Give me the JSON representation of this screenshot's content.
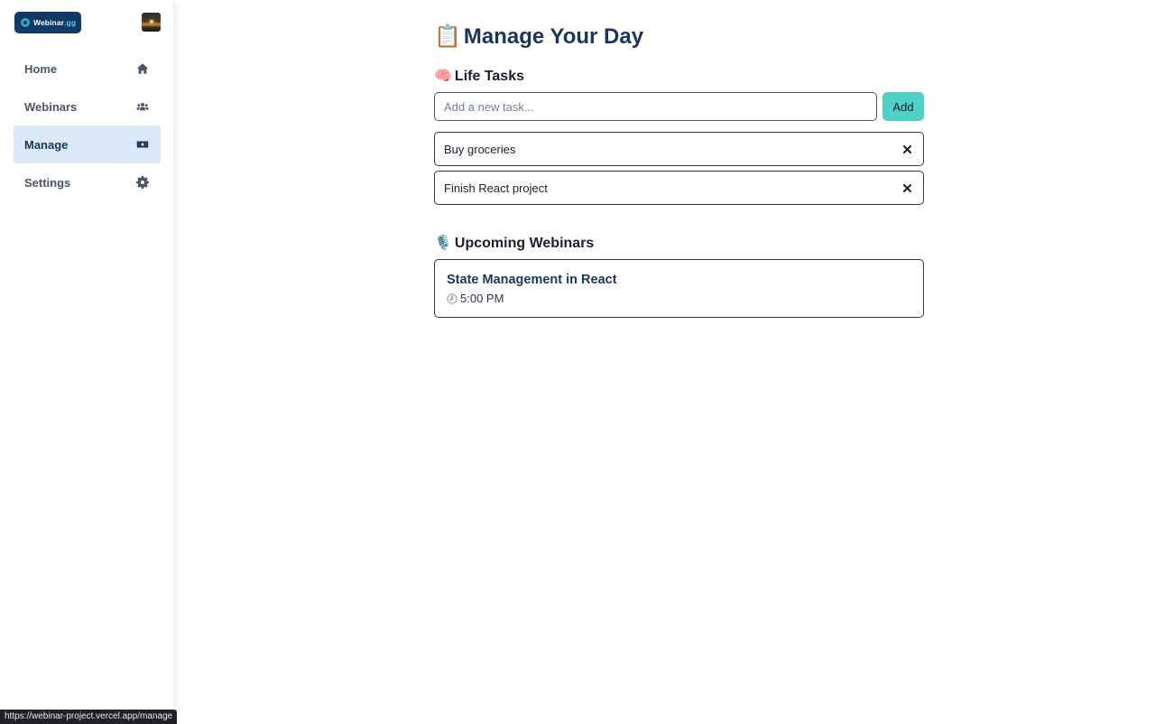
{
  "app": {
    "logo_text": "Webinar",
    "logo_tld": ".gg"
  },
  "sidebar": {
    "items": [
      {
        "label": "Home",
        "icon": "home-icon",
        "active": false
      },
      {
        "label": "Webinars",
        "icon": "users-icon",
        "active": false
      },
      {
        "label": "Manage",
        "icon": "money-bill-icon",
        "active": true
      },
      {
        "label": "Settings",
        "icon": "gear-icon",
        "active": false
      }
    ]
  },
  "main": {
    "title_emoji": "📋",
    "title": "Manage Your Day",
    "tasks_section": {
      "emoji": "🧠",
      "title": "Life Tasks",
      "input_placeholder": "Add a new task...",
      "input_value": "",
      "add_label": "Add",
      "tasks": [
        {
          "label": "Buy groceries"
        },
        {
          "label": "Finish React project"
        }
      ]
    },
    "webinars_section": {
      "emoji": "🎙️",
      "title": "Upcoming Webinars",
      "webinars": [
        {
          "title": "State Management in React",
          "time": "5:00 PM"
        }
      ]
    }
  },
  "status_bar": {
    "url": "https://webinar-project.vercel.app/manage"
  },
  "colors": {
    "brand_navy": "#1a365d",
    "accent_teal": "#4fd1c5",
    "active_nav_bg": "#dbe9f8"
  }
}
